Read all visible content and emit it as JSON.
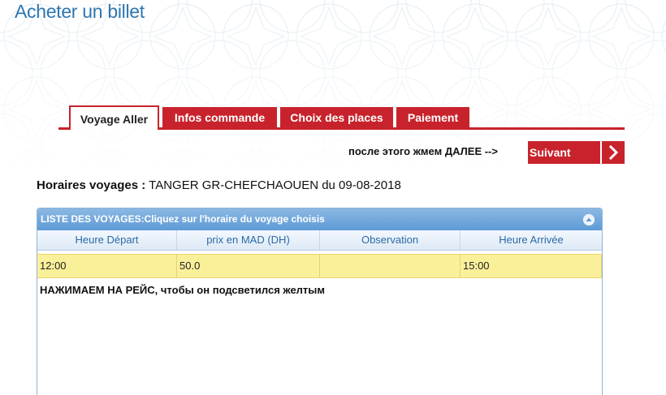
{
  "page": {
    "title": "Acheter un billet"
  },
  "tabs": [
    {
      "label": "Voyage Aller",
      "active": true
    },
    {
      "label": "Infos commande",
      "active": false
    },
    {
      "label": "Choix des places",
      "active": false
    },
    {
      "label": "Paiement",
      "active": false
    }
  ],
  "next": {
    "hint": "после этого жмем ДАЛЕЕ -->",
    "label": "Suivant",
    "arrow_icon": "chevron-right-icon"
  },
  "schedule": {
    "label": "Horaires voyages :",
    "route": "TANGER GR-CHEFCHAOUEN du 09-08-2018"
  },
  "grid": {
    "caption": "LISTE DES VOYAGES:Cliquez sur l'horaire du voyage choisis",
    "collapse_icon": "collapse-up-icon",
    "columns": [
      "Heure Départ",
      "prix en MAD (DH)",
      "Observation",
      "Heure Arrivée"
    ],
    "rows": [
      {
        "departure": "12:00",
        "price": "50.0",
        "observation": "",
        "arrival": "15:00",
        "selected": true
      }
    ],
    "note": "НАЖИМАЕМ НА РЕЙС, чтобы он подсветился желтым"
  },
  "colors": {
    "accent_red": "#c8232c",
    "title_blue": "#2f76b0",
    "grid_header_blue": "#5d9bd6",
    "selected_row": "#fbf09a"
  }
}
